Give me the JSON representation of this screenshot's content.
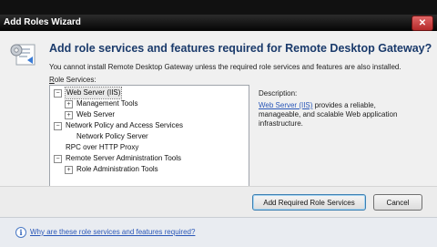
{
  "window": {
    "title": "Add Roles Wizard",
    "close_glyph": "✕"
  },
  "header": {
    "heading": "Add role services and features required for Remote Desktop Gateway?",
    "message": "You cannot install Remote Desktop Gateway unless the required role services and features are also installed."
  },
  "role_services": {
    "label_accel": "R",
    "label_rest": "ole Services:",
    "items": [
      {
        "label": "Web Server (IIS)",
        "toggle": "−"
      },
      {
        "label": "Management Tools",
        "toggle": "+"
      },
      {
        "label": "Web Server",
        "toggle": "+"
      },
      {
        "label": "Network Policy and Access Services",
        "toggle": "−"
      },
      {
        "label": "Network Policy Server",
        "toggle": ""
      },
      {
        "label": "RPC over HTTP Proxy",
        "toggle": ""
      },
      {
        "label": "Remote Server Administration Tools",
        "toggle": "−"
      },
      {
        "label": "Role Administration Tools",
        "toggle": "+"
      }
    ]
  },
  "description": {
    "label": "Description:",
    "link": "Web Server (IIS)",
    "text": " provides a reliable, manageable, and scalable Web application infrastructure."
  },
  "buttons": {
    "add": "Add Required Role Services",
    "cancel": "Cancel"
  },
  "footer": {
    "info_glyph": "i",
    "help_link": "Why are these role services and features required?"
  },
  "colors": {
    "heading": "#1a3a6b",
    "link": "#2a57b8"
  }
}
